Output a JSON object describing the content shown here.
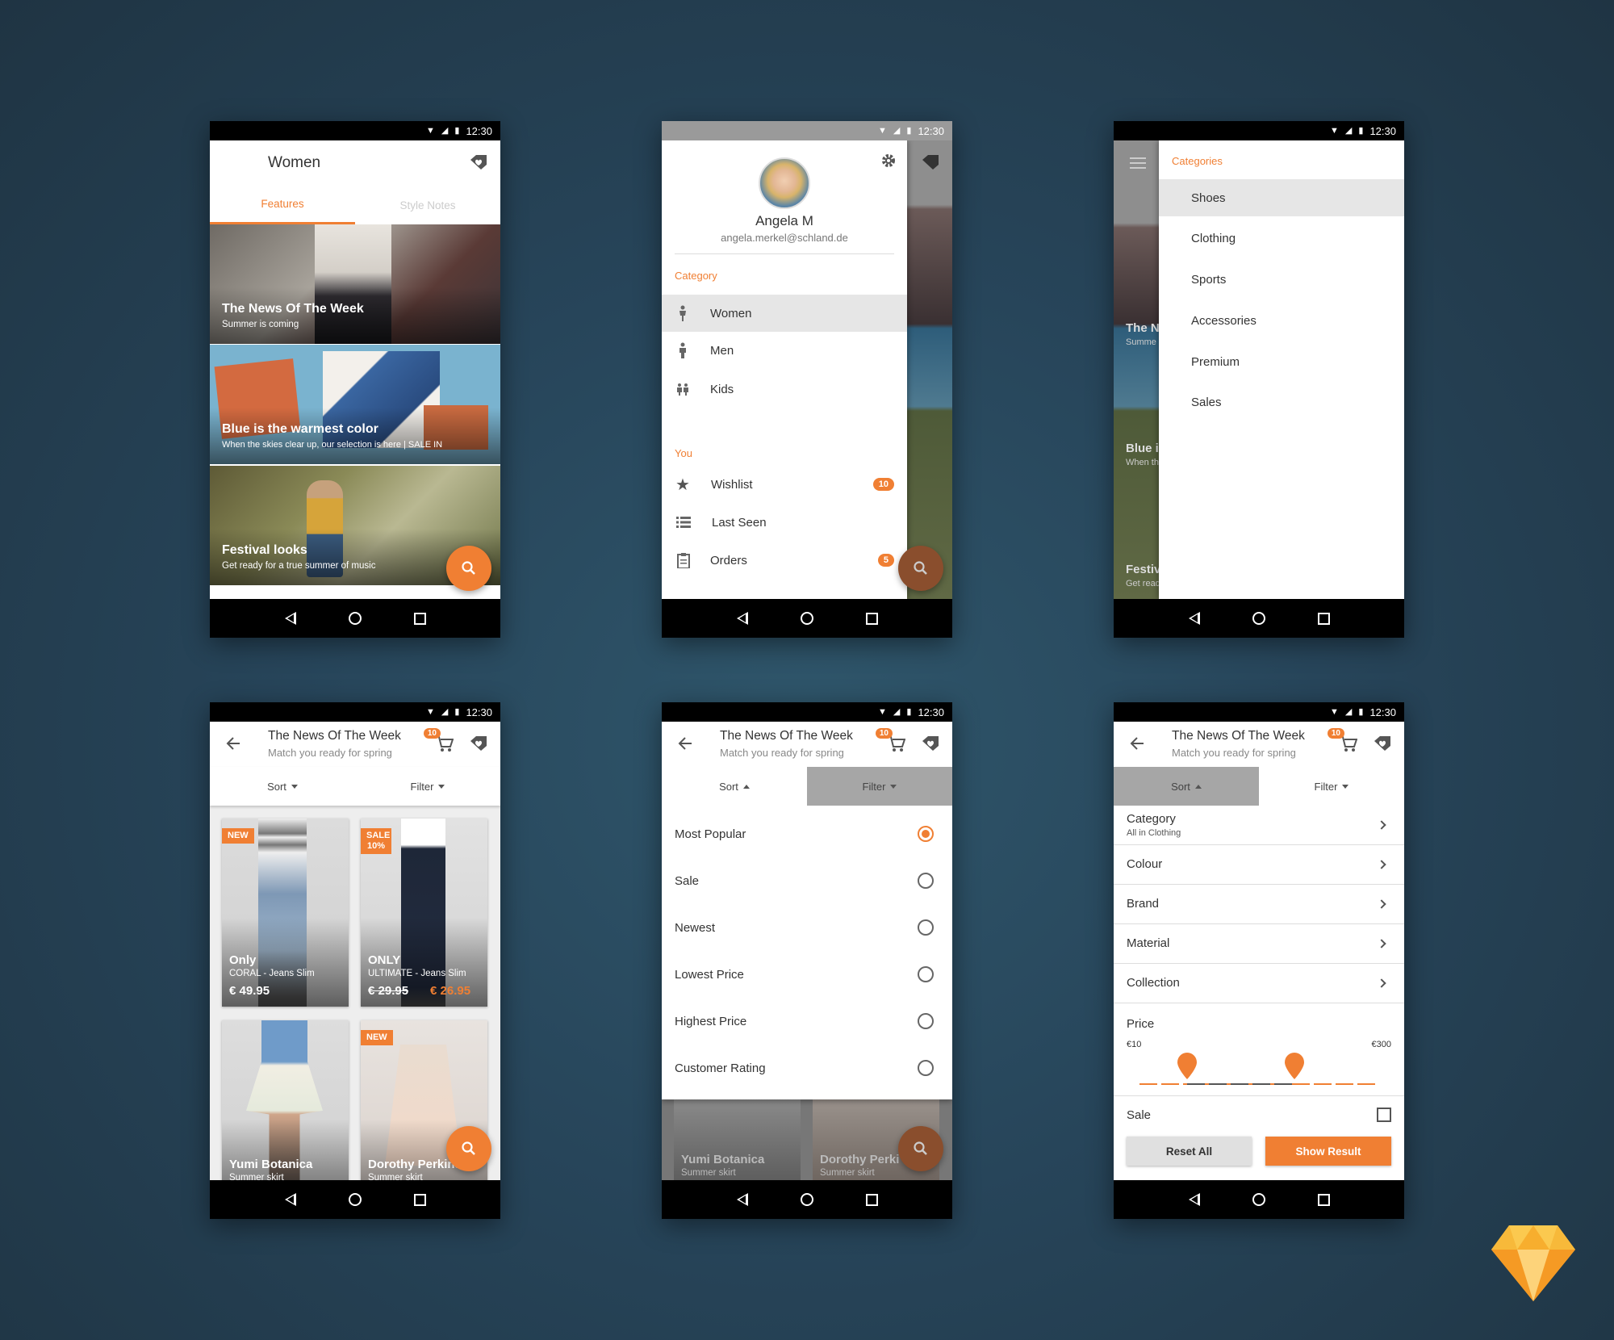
{
  "status": {
    "time": "12:30"
  },
  "screen1": {
    "title": "Women",
    "tabs": [
      "Features",
      "Style Notes"
    ],
    "cards": [
      {
        "title": "The News Of The Week",
        "subtitle": "Summer is coming"
      },
      {
        "title": "Blue is the warmest color",
        "subtitle": "When the skies clear up, our selection is here | SALE IN"
      },
      {
        "title": "Festival looks",
        "subtitle": "Get ready for a true summer of music"
      }
    ]
  },
  "screen2": {
    "user_name": "Angela M",
    "user_email": "angela.merkel@schland.de",
    "category_heading": "Category",
    "category_items": [
      "Women",
      "Men",
      "Kids"
    ],
    "you_heading": "You",
    "you_items": [
      {
        "label": "Wishlist",
        "badge": "10"
      },
      {
        "label": "Last Seen",
        "badge": ""
      },
      {
        "label": "Orders",
        "badge": "5"
      }
    ]
  },
  "screen3": {
    "heading": "Categories",
    "items": [
      "Shoes",
      "Clothing",
      "Sports",
      "Accessories",
      "Premium",
      "Sales"
    ],
    "bg_cards": [
      {
        "title": "The N",
        "subtitle": "Summe"
      },
      {
        "title": "Blue i",
        "subtitle": "When th"
      },
      {
        "title": "Festiv",
        "subtitle": "Get read"
      }
    ]
  },
  "list_header": {
    "title": "The News Of The Week",
    "subtitle": "Match you ready for spring",
    "cart_badge": "10",
    "sort_label": "Sort",
    "filter_label": "Filter"
  },
  "screen4": {
    "products": [
      {
        "tag": "NEW",
        "brand": "Only",
        "name": "CORAL - Jeans Slim",
        "price": "€ 49.95",
        "old_price": "",
        "sale_price": ""
      },
      {
        "tag": "SALE 10%",
        "brand": "ONLY",
        "name": "ULTIMATE - Jeans Slim",
        "price": "",
        "old_price": "€ 29.95",
        "sale_price": "€ 26.95"
      },
      {
        "tag": "",
        "brand": "Yumi Botanica",
        "name": "Summer skirt",
        "price": "",
        "old_price": "",
        "sale_price": ""
      },
      {
        "tag": "NEW",
        "brand": "Dorothy Perkins",
        "name": "Summer skirt",
        "price": "",
        "old_price": "",
        "sale_price": ""
      }
    ]
  },
  "screen5": {
    "sort_options": [
      {
        "label": "Most Popular",
        "selected": true
      },
      {
        "label": "Sale",
        "selected": false
      },
      {
        "label": "Newest",
        "selected": false
      },
      {
        "label": "Lowest Price",
        "selected": false
      },
      {
        "label": "Highest Price",
        "selected": false
      },
      {
        "label": "Customer Rating",
        "selected": false
      }
    ],
    "bg_products": [
      {
        "brand": "Yumi Botanica",
        "name": "Summer skirt"
      },
      {
        "brand": "Dorothy Perki",
        "name": "Summer skirt"
      }
    ]
  },
  "screen6": {
    "category_label": "Category",
    "category_value": "All in Clothing",
    "filters": [
      "Colour",
      "Brand",
      "Material",
      "Collection"
    ],
    "price_label": "Price",
    "price_min": "€10",
    "price_max": "€300",
    "price_range_low": 0.2,
    "price_range_high": 0.65,
    "sale_label": "Sale",
    "sale_checked": false,
    "reset_label": "Reset All",
    "show_label": "Show Result"
  },
  "colors": {
    "accent": "#f07f33",
    "background": "#27455a"
  }
}
